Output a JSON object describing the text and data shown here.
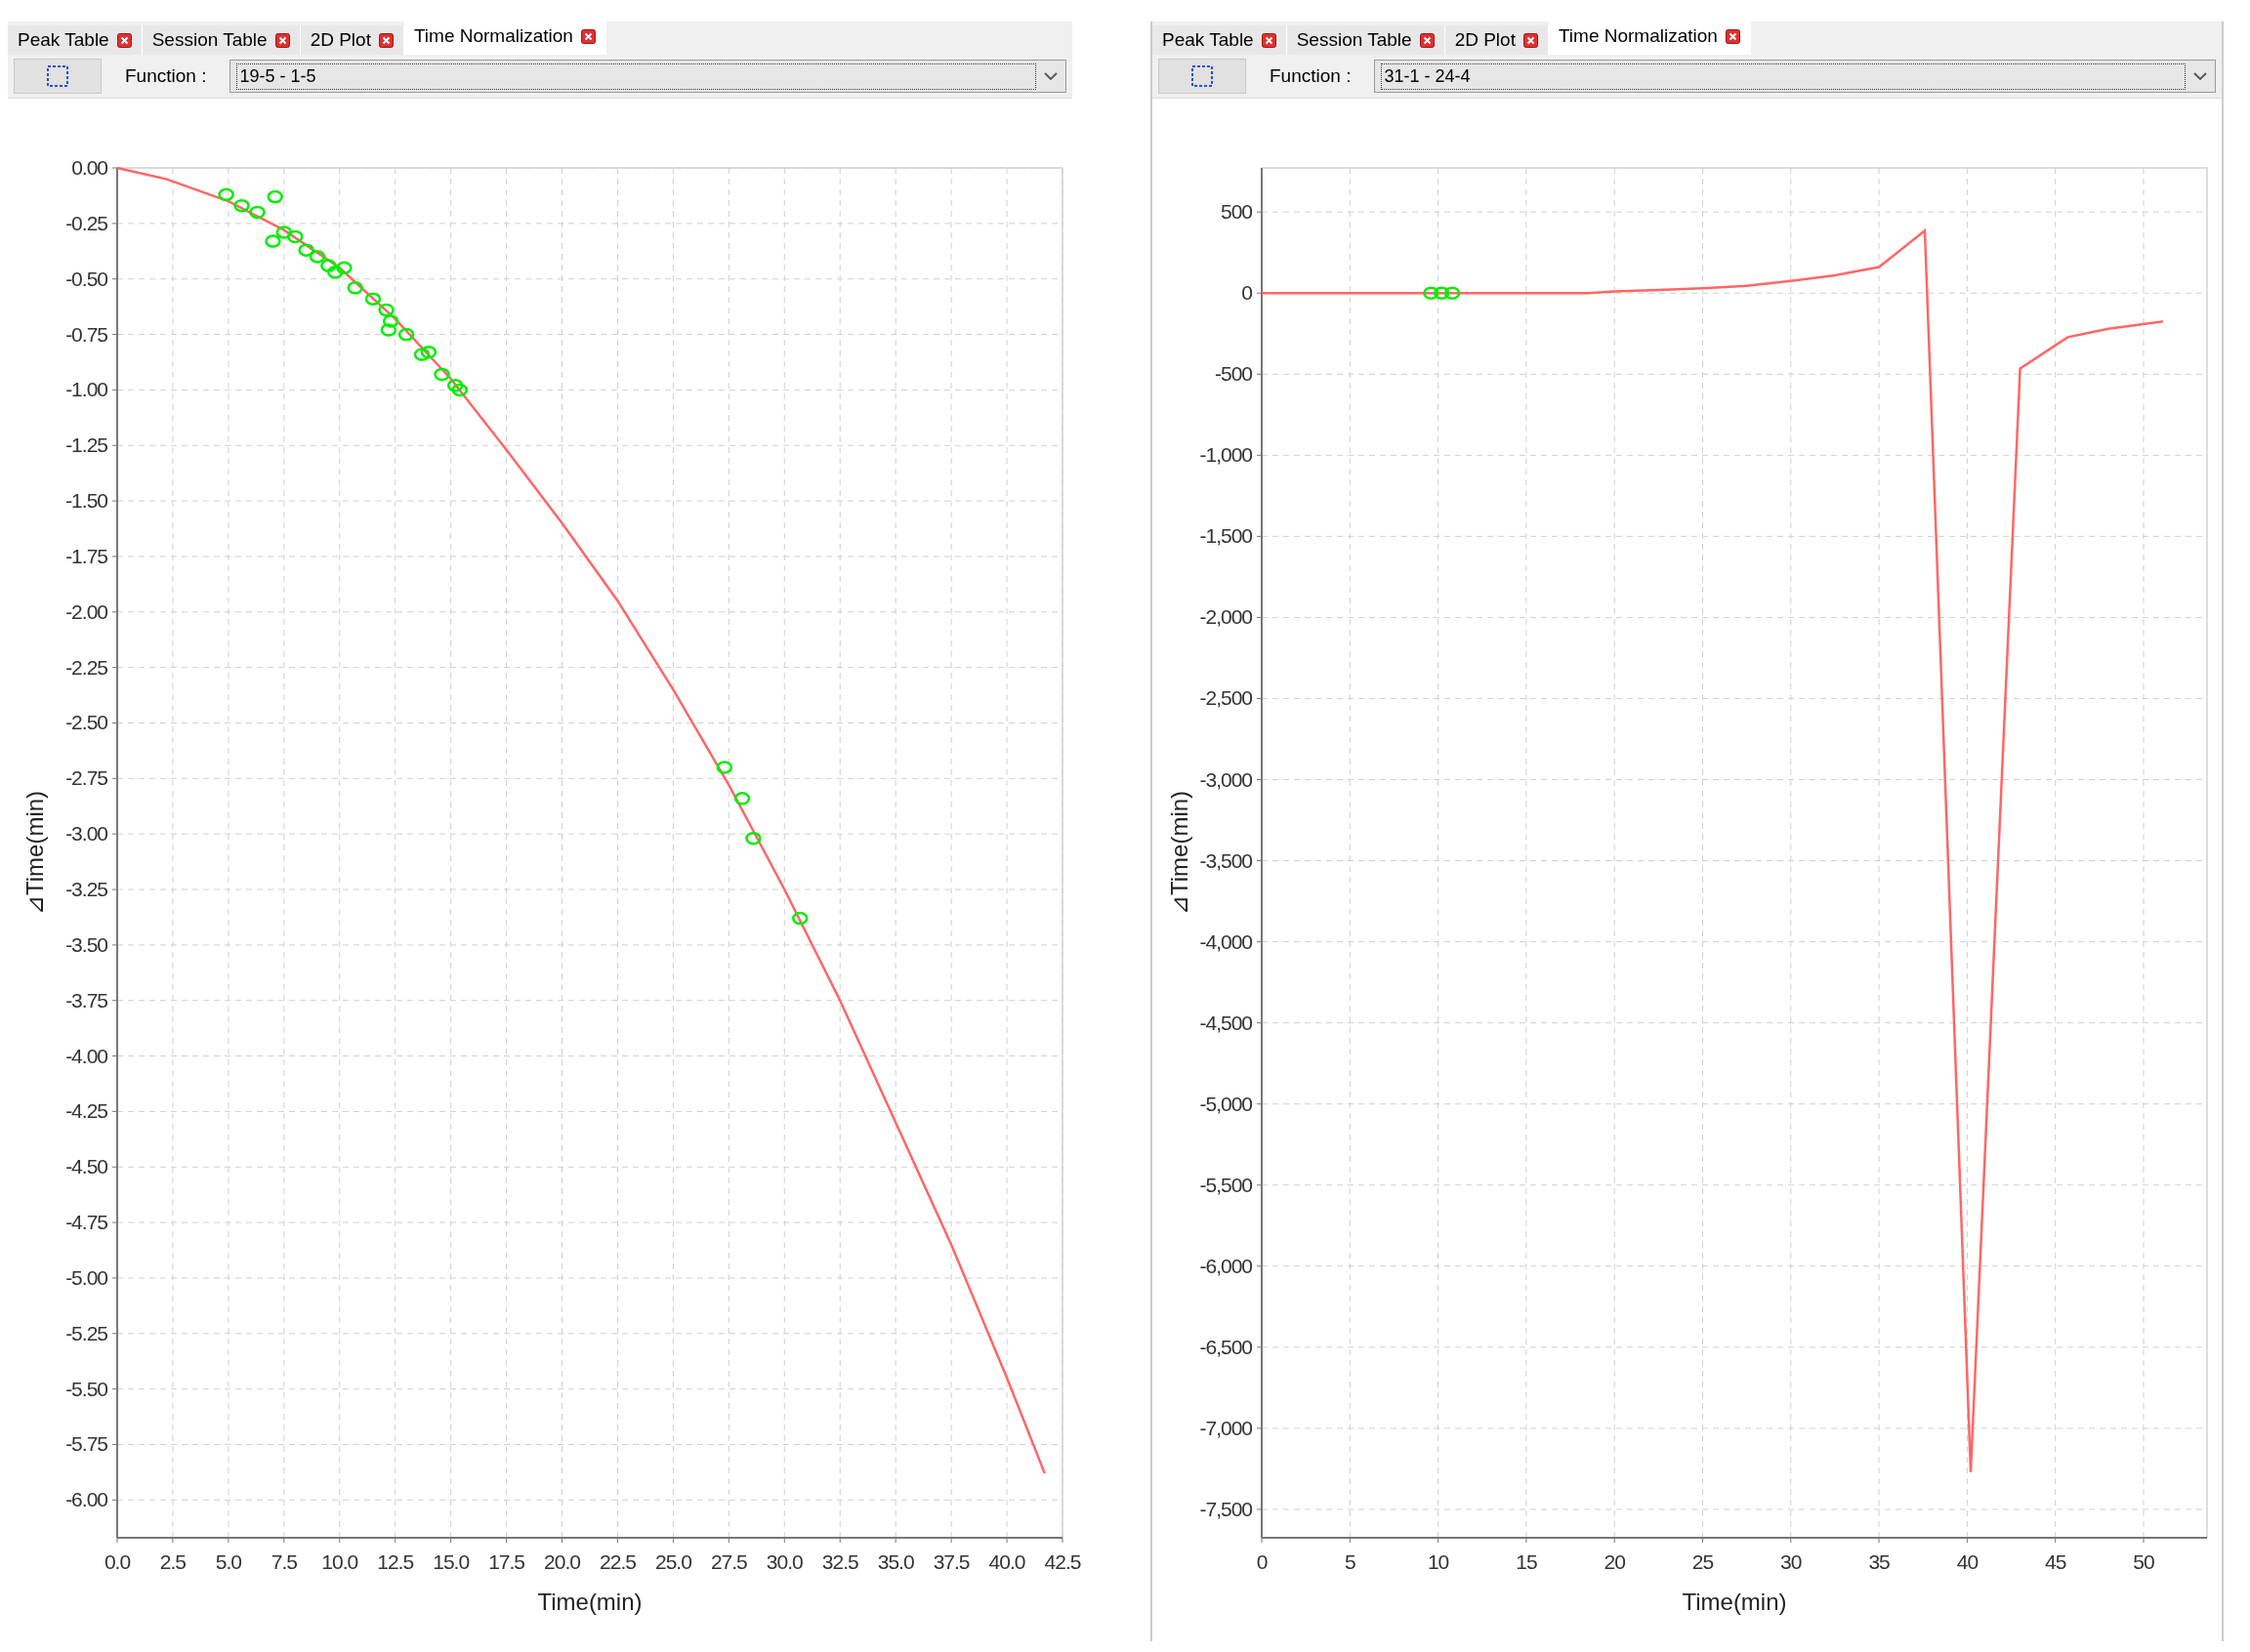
{
  "panels": [
    {
      "tabs": [
        {
          "label": "Peak Table",
          "selected": false
        },
        {
          "label": "Session Table",
          "selected": false
        },
        {
          "label": "2D Plot",
          "selected": false
        },
        {
          "label": "Time Normalization",
          "selected": true
        }
      ],
      "function_label": "Function :",
      "function_value": "19-5 - 1-5",
      "chart_data": {
        "type": "line",
        "grid": true,
        "xlabel": "Time(min)",
        "ylabel": "⊿Time(min)",
        "xlim": [
          0,
          42.5
        ],
        "ylim": [
          -6.17,
          0
        ],
        "xticks": [
          {
            "value": 0,
            "label": "0.0"
          },
          {
            "value": 2.5,
            "label": "2.5"
          },
          {
            "value": 5,
            "label": "5.0"
          },
          {
            "value": 7.5,
            "label": "7.5"
          },
          {
            "value": 10,
            "label": "10.0"
          },
          {
            "value": 12.5,
            "label": "12.5"
          },
          {
            "value": 15,
            "label": "15.0"
          },
          {
            "value": 17.5,
            "label": "17.5"
          },
          {
            "value": 20,
            "label": "20.0"
          },
          {
            "value": 22.5,
            "label": "22.5"
          },
          {
            "value": 25,
            "label": "25.0"
          },
          {
            "value": 27.5,
            "label": "27.5"
          },
          {
            "value": 30,
            "label": "30.0"
          },
          {
            "value": 32.5,
            "label": "32.5"
          },
          {
            "value": 35,
            "label": "35.0"
          },
          {
            "value": 37.5,
            "label": "37.5"
          },
          {
            "value": 40,
            "label": "40.0"
          },
          {
            "value": 42.5,
            "label": "42.5"
          }
        ],
        "yticks": [
          {
            "value": 0,
            "label": "0.00"
          },
          {
            "value": -0.25,
            "label": "-0.25"
          },
          {
            "value": -0.5,
            "label": "-0.50"
          },
          {
            "value": -0.75,
            "label": "-0.75"
          },
          {
            "value": -1,
            "label": "-1.00"
          },
          {
            "value": -1.25,
            "label": "-1.25"
          },
          {
            "value": -1.5,
            "label": "-1.50"
          },
          {
            "value": -1.75,
            "label": "-1.75"
          },
          {
            "value": -2,
            "label": "-2.00"
          },
          {
            "value": -2.25,
            "label": "-2.25"
          },
          {
            "value": -2.5,
            "label": "-2.50"
          },
          {
            "value": -2.75,
            "label": "-2.75"
          },
          {
            "value": -3,
            "label": "-3.00"
          },
          {
            "value": -3.25,
            "label": "-3.25"
          },
          {
            "value": -3.5,
            "label": "-3.50"
          },
          {
            "value": -3.75,
            "label": "-3.75"
          },
          {
            "value": -4,
            "label": "-4.00"
          },
          {
            "value": -4.25,
            "label": "-4.25"
          },
          {
            "value": -4.5,
            "label": "-4.50"
          },
          {
            "value": -4.75,
            "label": "-4.75"
          },
          {
            "value": -5,
            "label": "-5.00"
          },
          {
            "value": -5.25,
            "label": "-5.25"
          },
          {
            "value": -5.5,
            "label": "-5.50"
          },
          {
            "value": -5.75,
            "label": "-5.75"
          },
          {
            "value": -6,
            "label": "-6.00"
          }
        ],
        "series": [
          {
            "type": "line",
            "color": "#ff6666",
            "x": [
              0,
              2.2,
              5,
              7.5,
              10,
              12.5,
              15,
              17.5,
              20,
              22.5,
              25,
              27.5,
              30,
              32.5,
              35,
              37.5,
              40,
              41.7
            ],
            "values": [
              0,
              -0.05,
              -0.15,
              -0.28,
              -0.45,
              -0.68,
              -0.95,
              -1.27,
              -1.6,
              -1.95,
              -2.35,
              -2.78,
              -3.25,
              -3.75,
              -4.3,
              -4.85,
              -5.45,
              -5.88
            ]
          },
          {
            "type": "scatter",
            "color": "#00ee00",
            "x": [
              4.9,
              5.6,
              6.3,
              7.1,
              7,
              7.5,
              8,
              8.5,
              9,
              9.5,
              9.8,
              10.2,
              10.7,
              11.5,
              12.1,
              12.3,
              12.2,
              13,
              13.7,
              14,
              14.6,
              15.2,
              15.4,
              27.3,
              28.1,
              28.6,
              30.7
            ],
            "values": [
              -0.12,
              -0.17,
              -0.2,
              -0.13,
              -0.33,
              -0.29,
              -0.31,
              -0.37,
              -0.4,
              -0.44,
              -0.47,
              -0.45,
              -0.54,
              -0.59,
              -0.64,
              -0.69,
              -0.73,
              -0.75,
              -0.84,
              -0.83,
              -0.93,
              -0.98,
              -1.0,
              -2.7,
              -2.84,
              -3.02,
              -3.38
            ]
          }
        ]
      }
    },
    {
      "tabs": [
        {
          "label": "Peak Table",
          "selected": false
        },
        {
          "label": "Session Table",
          "selected": false
        },
        {
          "label": "2D Plot",
          "selected": false
        },
        {
          "label": "Time Normalization",
          "selected": true
        }
      ],
      "function_label": "Function :",
      "function_value": "31-1 - 24-4",
      "chart_data": {
        "type": "line",
        "grid": true,
        "xlabel": "Time(min)",
        "ylabel": "⊿Time(min)",
        "xlim": [
          0,
          53.6
        ],
        "ylim": [
          -7675,
          772
        ],
        "xticks": [
          {
            "value": 0,
            "label": "0"
          },
          {
            "value": 5,
            "label": "5"
          },
          {
            "value": 10,
            "label": "10"
          },
          {
            "value": 15,
            "label": "15"
          },
          {
            "value": 20,
            "label": "20"
          },
          {
            "value": 25,
            "label": "25"
          },
          {
            "value": 30,
            "label": "30"
          },
          {
            "value": 35,
            "label": "35"
          },
          {
            "value": 40,
            "label": "40"
          },
          {
            "value": 45,
            "label": "45"
          },
          {
            "value": 50,
            "label": "50"
          }
        ],
        "yticks": [
          {
            "value": 500,
            "label": "500"
          },
          {
            "value": 0,
            "label": "0"
          },
          {
            "value": -500,
            "label": "-500"
          },
          {
            "value": -1000,
            "label": "-1,000"
          },
          {
            "value": -1500,
            "label": "-1,500"
          },
          {
            "value": -2000,
            "label": "-2,000"
          },
          {
            "value": -2500,
            "label": "-2,500"
          },
          {
            "value": -3000,
            "label": "-3,000"
          },
          {
            "value": -3500,
            "label": "-3,500"
          },
          {
            "value": -4000,
            "label": "-4,000"
          },
          {
            "value": -4500,
            "label": "-4,500"
          },
          {
            "value": -5000,
            "label": "-5,000"
          },
          {
            "value": -5500,
            "label": "-5,500"
          },
          {
            "value": -6000,
            "label": "-6,000"
          },
          {
            "value": -6500,
            "label": "-6,500"
          },
          {
            "value": -7000,
            "label": "-7,000"
          },
          {
            "value": -7500,
            "label": "-7,500"
          }
        ],
        "series": [
          {
            "type": "line",
            "color": "#ff6666",
            "x": [
              0,
              5,
              10,
              15,
              18.5,
              20,
              22.5,
              25,
              27.5,
              30,
              32.5,
              35,
              37.6,
              40.2,
              43,
              45.7,
              48,
              51.1
            ],
            "values": [
              0,
              0,
              0,
              0,
              0,
              10,
              20,
              30,
              45,
              75,
              110,
              160,
              385,
              -7270,
              -465,
              -272,
              -220,
              -175
            ]
          },
          {
            "type": "scatter",
            "color": "#00ee00",
            "x": [
              9.6,
              10.2,
              10.8
            ],
            "values": [
              0,
              0,
              0
            ]
          }
        ]
      }
    }
  ]
}
